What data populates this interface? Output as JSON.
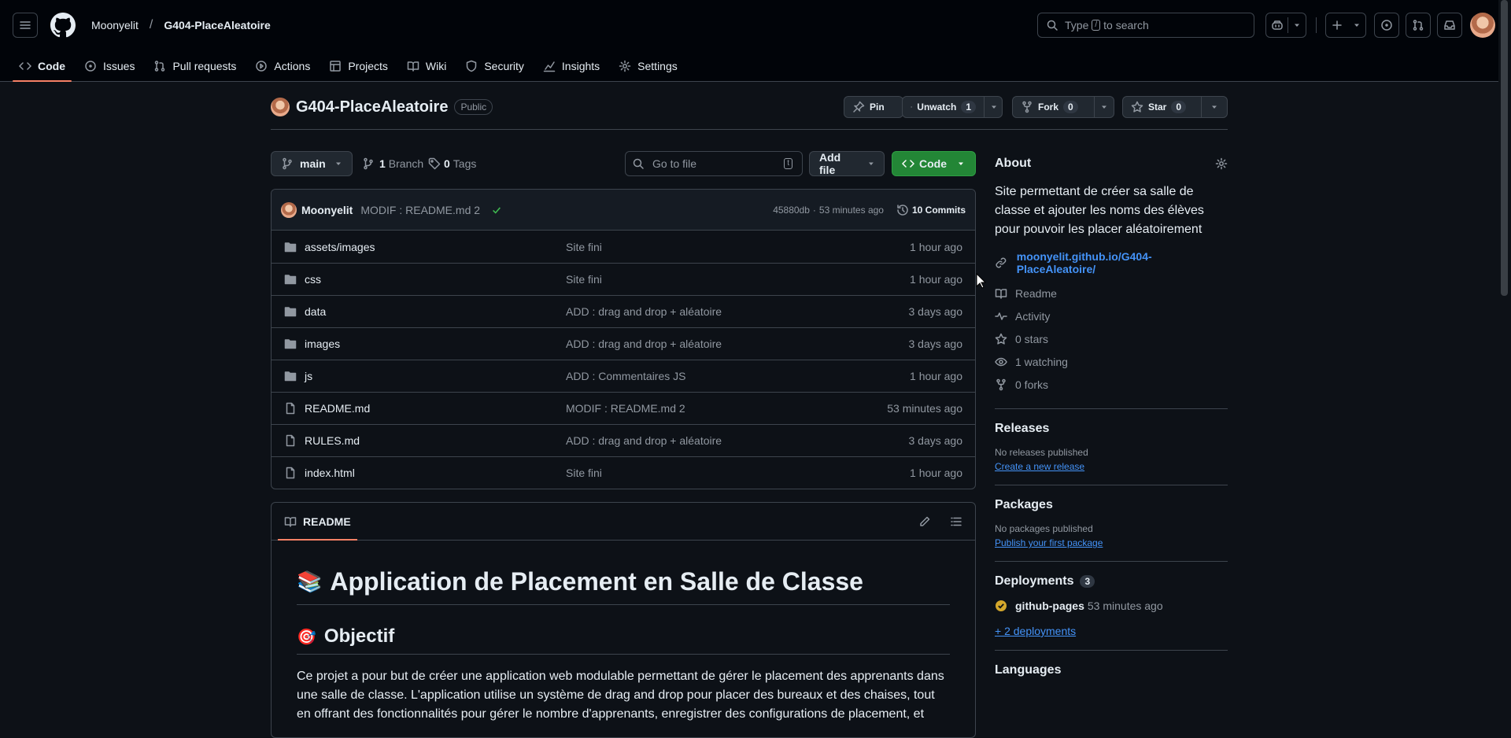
{
  "header": {
    "owner": "Moonyelit",
    "repo": "G404-PlaceAleatoire",
    "search_prefix": "Type",
    "search_key": "/",
    "search_suffix": "to search"
  },
  "nav": {
    "tabs": [
      {
        "label": "Code",
        "icon": "code-icon"
      },
      {
        "label": "Issues",
        "icon": "issue-icon"
      },
      {
        "label": "Pull requests",
        "icon": "pull-request-icon"
      },
      {
        "label": "Actions",
        "icon": "play-icon"
      },
      {
        "label": "Projects",
        "icon": "table-icon"
      },
      {
        "label": "Wiki",
        "icon": "book-icon"
      },
      {
        "label": "Security",
        "icon": "shield-icon"
      },
      {
        "label": "Insights",
        "icon": "graph-icon"
      },
      {
        "label": "Settings",
        "icon": "gear-icon"
      }
    ]
  },
  "repo_head": {
    "name": "G404-PlaceAleatoire",
    "visibility": "Public",
    "pin": "Pin",
    "unwatch": "Unwatch",
    "watch_count": "1",
    "fork": "Fork",
    "fork_count": "0",
    "star": "Star",
    "star_count": "0"
  },
  "toolbar": {
    "branch": "main",
    "branch_count": "1",
    "branch_label": "Branch",
    "tag_count": "0",
    "tag_label": "Tags",
    "goto_placeholder": "Go to file",
    "goto_key": "t",
    "add_file": "Add file",
    "code": "Code"
  },
  "commit": {
    "author": "Moonyelit",
    "message": "MODIF : README.md 2",
    "hash": "45880db",
    "sep": "·",
    "time": "53 minutes ago",
    "commits": "10 Commits"
  },
  "files": [
    {
      "name": "assets/images",
      "type": "dir",
      "message": "Site fini",
      "date": "1 hour ago"
    },
    {
      "name": "css",
      "type": "dir",
      "message": "Site fini",
      "date": "1 hour ago"
    },
    {
      "name": "data",
      "type": "dir",
      "message": "ADD : drag and drop + aléatoire",
      "date": "3 days ago"
    },
    {
      "name": "images",
      "type": "dir",
      "message": "ADD : drag and drop + aléatoire",
      "date": "3 days ago"
    },
    {
      "name": "js",
      "type": "dir",
      "message": "ADD : Commentaires JS",
      "date": "1 hour ago"
    },
    {
      "name": "README.md",
      "type": "file",
      "message": "MODIF : README.md 2",
      "date": "53 minutes ago"
    },
    {
      "name": "RULES.md",
      "type": "file",
      "message": "ADD : drag and drop + aléatoire",
      "date": "3 days ago"
    },
    {
      "name": "index.html",
      "type": "file",
      "message": "Site fini",
      "date": "1 hour ago"
    }
  ],
  "readme": {
    "tab": "README",
    "h1_emoji": "📚",
    "h1": "Application de Placement en Salle de Classe",
    "h2_emoji": "🎯",
    "h2": "Objectif",
    "p": "Ce projet a pour but de créer une application web modulable permettant de gérer le placement des apprenants dans une salle de classe. L'application utilise un système de drag and drop pour placer des bureaux et des chaises, tout en offrant des fonctionnalités pour gérer le nombre d'apprenants, enregistrer des configurations de placement, et"
  },
  "about": {
    "title": "About",
    "description": "Site permettant de créer sa salle de classe et ajouter les noms des élèves pour pouvoir les placer aléatoirement",
    "link": "moonyelit.github.io/G404-PlaceAleatoire/",
    "readme": "Readme",
    "activity": "Activity",
    "stars": "0 stars",
    "watching": "1 watching",
    "forks": "0 forks"
  },
  "releases": {
    "title": "Releases",
    "none": "No releases published",
    "create": "Create a new release"
  },
  "packages": {
    "title": "Packages",
    "none": "No packages published",
    "publish": "Publish your first package"
  },
  "deployments": {
    "title": "Deployments",
    "count": "3",
    "env": "github-pages",
    "time": "53 minutes ago",
    "more": "+ 2 deployments"
  },
  "languages": {
    "title": "Languages"
  },
  "colors": {
    "bg": "#0d1117",
    "header": "#010409",
    "border": "#3d444d",
    "accent": "#f78166",
    "green": "#238636",
    "link": "#4493f8"
  }
}
